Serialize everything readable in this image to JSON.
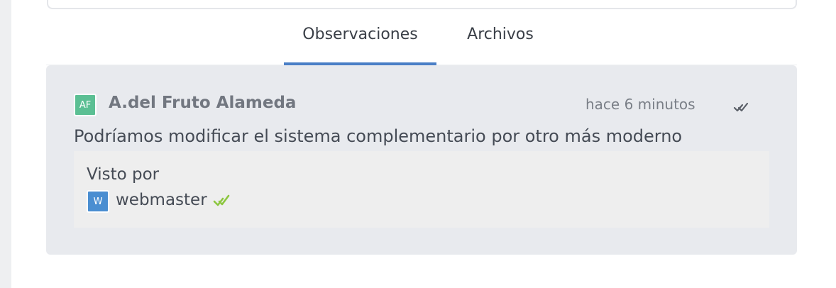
{
  "tabs": [
    {
      "label": "Observaciones",
      "active": true
    },
    {
      "label": "Archivos",
      "active": false
    }
  ],
  "colors": {
    "accent": "#4a7fc6",
    "author_avatar": "#5bbf93",
    "viewer_avatar": "#4a8ed1",
    "seen_check": "#8cc63f"
  },
  "comment": {
    "author_initials": "AF",
    "author_name": "A.del Fruto Alameda",
    "time_ago": "hace 6 minutos",
    "status_icon": "double-check-icon",
    "text": "Podríamos modificar el sistema complementario por otro más moderno",
    "seen_by": {
      "label": "Visto por",
      "users": [
        {
          "initial": "W",
          "name": "webmaster",
          "icon": "double-check-icon"
        }
      ]
    }
  }
}
